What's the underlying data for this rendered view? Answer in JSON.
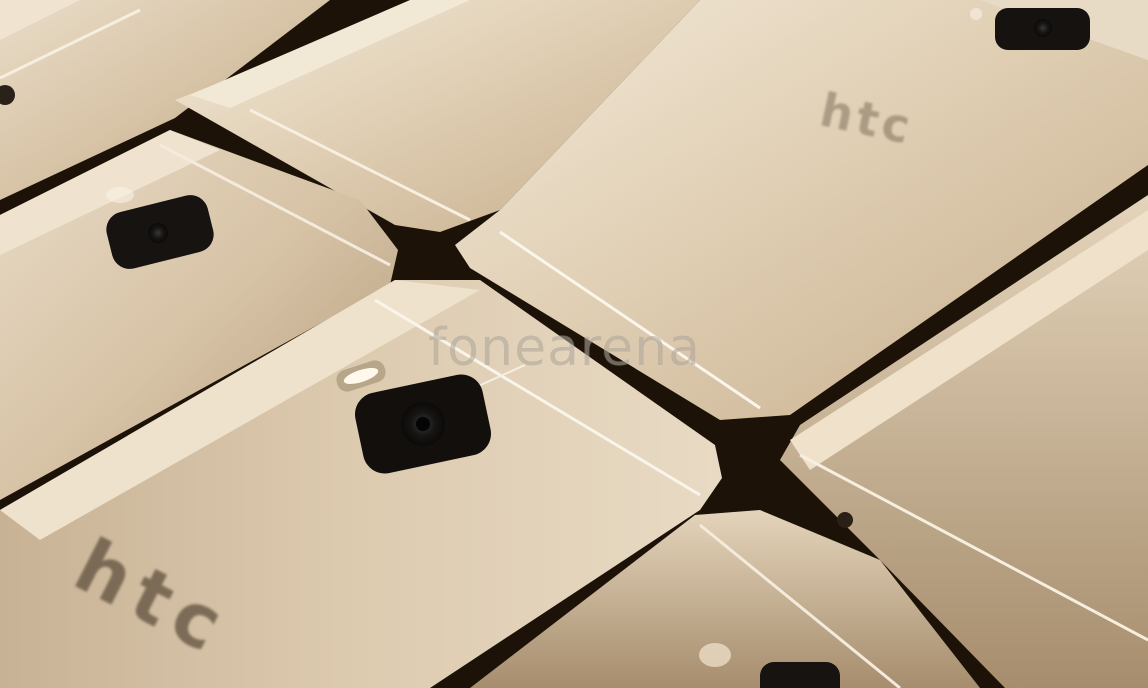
{
  "photo": {
    "subject": "htc-phones-gold-back",
    "watermark": "fonearena",
    "logo_text": [
      "htc",
      "htc"
    ],
    "colors": {
      "body_light": "#efe4d2",
      "body_mid": "#cdb89c",
      "body_dark": "#8a7256",
      "gap": "#1c1208",
      "camera": "#141211"
    }
  }
}
